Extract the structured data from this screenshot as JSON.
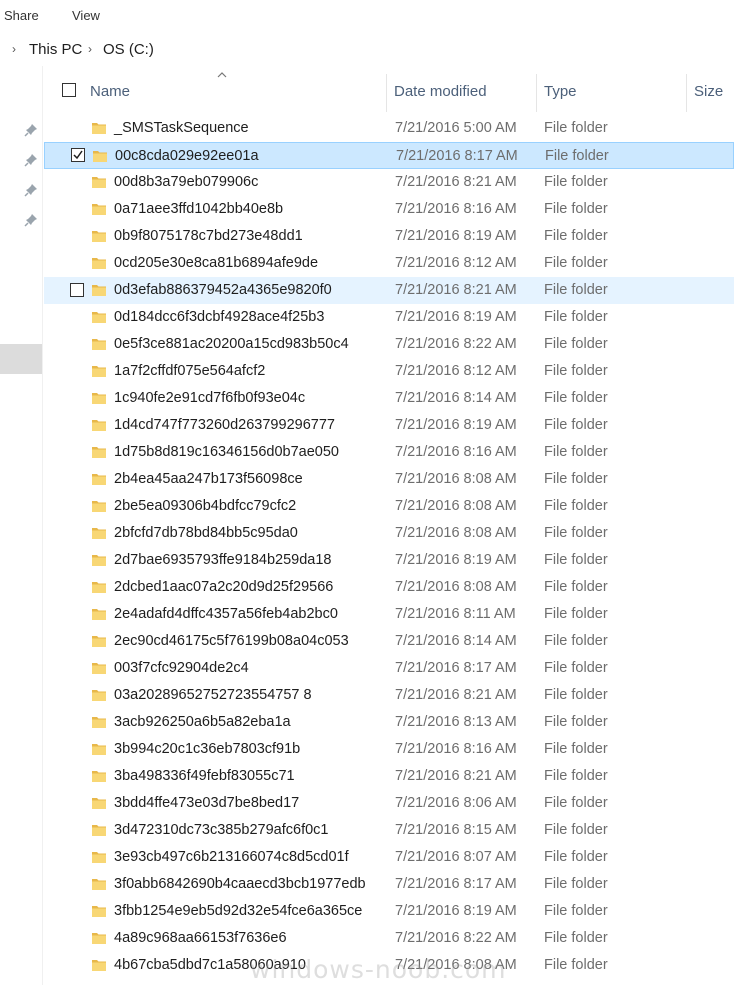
{
  "ribbon": {
    "share_label": "Share",
    "view_label": "View"
  },
  "address": {
    "crumbs": [
      "This PC",
      "OS (C:)"
    ]
  },
  "columns": {
    "name": "Name",
    "date": "Date modified",
    "type": "Type",
    "size": "Size"
  },
  "icons": {
    "folder": "folder-icon",
    "pin": "pin-icon",
    "checkbox": "checkbox-icon",
    "sort": "sort-ascending-icon"
  },
  "colors": {
    "selected_bg": "#cce8ff",
    "hover_bg": "#e5f3ff",
    "folder": "#f8d775"
  },
  "files": [
    {
      "name": "_SMSTaskSequence",
      "date": "7/21/2016 5:00 AM",
      "type": "File folder"
    },
    {
      "name": "00c8cda029e92ee01a",
      "date": "7/21/2016 8:17 AM",
      "type": "File folder",
      "state": "selected",
      "checked": true
    },
    {
      "name": "00d8b3a79eb079906c",
      "date": "7/21/2016 8:21 AM",
      "type": "File folder"
    },
    {
      "name": "0a71aee3ffd1042bb40e8b",
      "date": "7/21/2016 8:16 AM",
      "type": "File folder"
    },
    {
      "name": "0b9f8075178c7bd273e48dd1",
      "date": "7/21/2016 8:19 AM",
      "type": "File folder"
    },
    {
      "name": "0cd205e30e8ca81b6894afe9de",
      "date": "7/21/2016 8:12 AM",
      "type": "File folder"
    },
    {
      "name": "0d3efab886379452a4365e9820f0",
      "date": "7/21/2016 8:21 AM",
      "type": "File folder",
      "state": "hover",
      "checked": false
    },
    {
      "name": "0d184dcc6f3dcbf4928ace4f25b3",
      "date": "7/21/2016 8:19 AM",
      "type": "File folder"
    },
    {
      "name": "0e5f3ce881ac20200a15cd983b50c4",
      "date": "7/21/2016 8:22 AM",
      "type": "File folder"
    },
    {
      "name": "1a7f2cffdf075e564afcf2",
      "date": "7/21/2016 8:12 AM",
      "type": "File folder"
    },
    {
      "name": "1c940fe2e91cd7f6fb0f93e04c",
      "date": "7/21/2016 8:14 AM",
      "type": "File folder"
    },
    {
      "name": "1d4cd747f773260d263799296777",
      "date": "7/21/2016 8:19 AM",
      "type": "File folder"
    },
    {
      "name": "1d75b8d819c16346156d0b7ae050",
      "date": "7/21/2016 8:16 AM",
      "type": "File folder"
    },
    {
      "name": "2b4ea45aa247b173f56098ce",
      "date": "7/21/2016 8:08 AM",
      "type": "File folder"
    },
    {
      "name": "2be5ea09306b4bdfcc79cfc2",
      "date": "7/21/2016 8:08 AM",
      "type": "File folder"
    },
    {
      "name": "2bfcfd7db78bd84bb5c95da0",
      "date": "7/21/2016 8:08 AM",
      "type": "File folder"
    },
    {
      "name": "2d7bae6935793ffe9184b259da18",
      "date": "7/21/2016 8:19 AM",
      "type": "File folder"
    },
    {
      "name": "2dcbed1aac07a2c20d9d25f29566",
      "date": "7/21/2016 8:08 AM",
      "type": "File folder"
    },
    {
      "name": "2e4adafd4dffc4357a56feb4ab2bc0",
      "date": "7/21/2016 8:11 AM",
      "type": "File folder"
    },
    {
      "name": "2ec90cd46175c5f76199b08a04c053",
      "date": "7/21/2016 8:14 AM",
      "type": "File folder"
    },
    {
      "name": "003f7cfc92904de2c4",
      "date": "7/21/2016 8:17 AM",
      "type": "File folder"
    },
    {
      "name": "03a20289652752723554757 8",
      "date": "7/21/2016 8:21 AM",
      "type": "File folder"
    },
    {
      "name": "3acb926250a6b5a82eba1a",
      "date": "7/21/2016 8:13 AM",
      "type": "File folder"
    },
    {
      "name": "3b994c20c1c36eb7803cf91b",
      "date": "7/21/2016 8:16 AM",
      "type": "File folder"
    },
    {
      "name": "3ba498336f49febf83055c71",
      "date": "7/21/2016 8:21 AM",
      "type": "File folder"
    },
    {
      "name": "3bdd4ffe473e03d7be8bed17",
      "date": "7/21/2016 8:06 AM",
      "type": "File folder"
    },
    {
      "name": "3d472310dc73c385b279afc6f0c1",
      "date": "7/21/2016 8:15 AM",
      "type": "File folder"
    },
    {
      "name": "3e93cb497c6b213166074c8d5cd01f",
      "date": "7/21/2016 8:07 AM",
      "type": "File folder"
    },
    {
      "name": "3f0abb6842690b4caaecd3bcb1977edb",
      "date": "7/21/2016 8:17 AM",
      "type": "File folder"
    },
    {
      "name": "3fbb1254e9eb5d92d32e54fce6a365ce",
      "date": "7/21/2016 8:19 AM",
      "type": "File folder"
    },
    {
      "name": "4a89c968aa66153f7636e6",
      "date": "7/21/2016 8:22 AM",
      "type": "File folder"
    },
    {
      "name": "4b67cba5dbd7c1a58060a910",
      "date": "7/21/2016 8:08 AM",
      "type": "File folder"
    }
  ],
  "watermark": "windows-noob.com"
}
